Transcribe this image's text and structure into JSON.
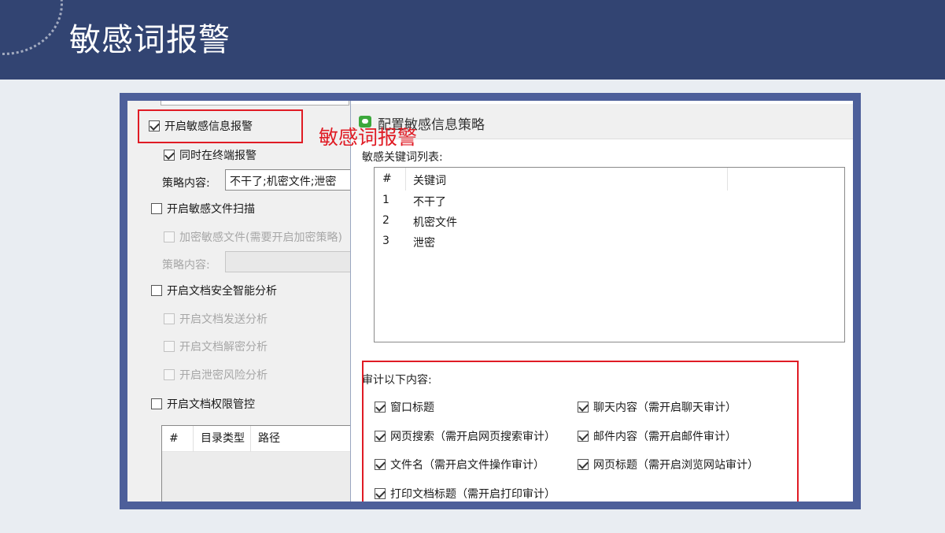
{
  "slide": {
    "title": "敏感词报警"
  },
  "left_panel": {
    "enable_alert_label": "开启敏感信息报警",
    "terminal_alert_label": "同时在终端报警",
    "policy_label": "策略内容:",
    "policy_value": "不干了;机密文件;泄密",
    "file_scan_label": "开启敏感文件扫描",
    "encrypt_label": "加密敏感文件(需要开启加密策略)",
    "policy_label_2": "策略内容:",
    "doc_analysis_label": "开启文档安全智能分析",
    "send_analysis_label": "开启文档发送分析",
    "decrypt_analysis_label": "开启文档解密分析",
    "leak_risk_label": "开启泄密风险分析",
    "permission_label": "开启文档权限管控",
    "dir_table": {
      "col_num": "#",
      "col_type": "目录类型",
      "col_path": "路径"
    }
  },
  "annotation": {
    "text": "敏感词报警"
  },
  "dialog": {
    "title": "配置敏感信息策略",
    "keyword_list_label": "敏感关键词列表:",
    "table_headers": {
      "num": "#",
      "keyword": "关键词"
    },
    "keywords": [
      {
        "num": "1",
        "keyword": "不干了"
      },
      {
        "num": "2",
        "keyword": "机密文件"
      },
      {
        "num": "3",
        "keyword": "泄密"
      }
    ],
    "audit_label": "审计以下内容:",
    "audit_items": {
      "window_title": "窗口标题",
      "chat_content": "聊天内容（需开启聊天审计）",
      "web_search": "网页搜索（需开启网页搜索审计）",
      "mail_content": "邮件内容（需开启邮件审计）",
      "file_name": "文件名（需开启文件操作审计）",
      "web_title": "网页标题（需开启浏览网站审计）",
      "print_title": "打印文档标题（需开启打印审计）"
    }
  },
  "colors": {
    "header_bg": "#324472",
    "frame_bg": "#4d5f9a",
    "highlight_red": "#e01b24"
  }
}
